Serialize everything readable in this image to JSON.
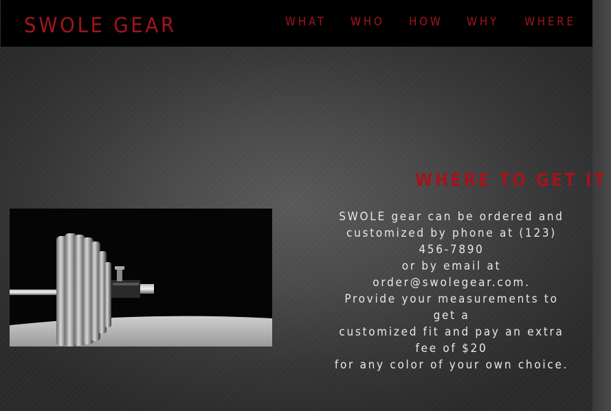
{
  "header": {
    "brand": "SWOLE GEAR",
    "nav": [
      "WHAT",
      "WHO",
      "HOW",
      "WHY",
      "WHERE"
    ]
  },
  "section": {
    "title": "WHERE TO GET IT",
    "description_lines": [
      "SWOLE gear can be ordered and",
      "customized by phone at (123) 456-7890",
      "or by email at order@swolegear.com.",
      "Provide your measurements to get a",
      "customized fit and pay an extra fee of $20",
      "for any color of your own choice."
    ]
  },
  "image": {
    "icon": "barbell-weight-plates-photo"
  },
  "colors": {
    "accent": "#a3141b",
    "navbar": "#000000",
    "text": "#e8e8e8"
  }
}
